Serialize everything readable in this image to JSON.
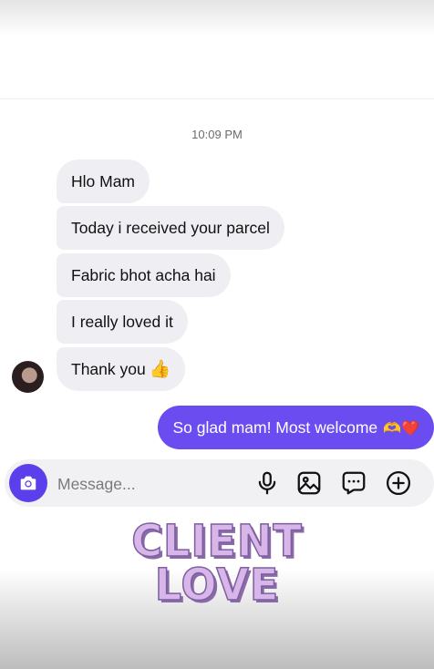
{
  "thread": {
    "timestamp": "10:09 PM",
    "incoming": [
      {
        "text": "Hlo Mam"
      },
      {
        "text": "Today i received your parcel"
      },
      {
        "text": "Fabric bhot acha hai"
      },
      {
        "text": "I really loved it"
      },
      {
        "text": "Thank you",
        "emoji": "👍"
      }
    ],
    "outgoing": [
      {
        "text": "So glad mam! Most welcome",
        "emoji": "🫶❤️"
      }
    ]
  },
  "composer": {
    "placeholder": "Message...",
    "icons": [
      "camera-icon",
      "microphone-icon",
      "gallery-icon",
      "sticker-icon",
      "plus-icon"
    ]
  },
  "overlay": {
    "line1": "CLIENT",
    "line2": "LOVE"
  },
  "colors": {
    "outgoing_bubble": "#6a4cf0",
    "incoming_bubble": "#efeff3",
    "camera_button": "#5b3fea",
    "overlay_text": "#d9b6ea"
  }
}
